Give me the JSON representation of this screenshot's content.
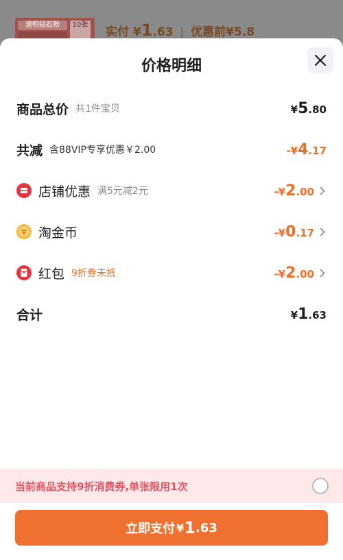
{
  "background": {
    "thumb_title": "透明钻石款",
    "thumb_count": "10张",
    "pay_label": "实付",
    "pay_currency": "¥",
    "pay_int": "1",
    "pay_dec": ".63",
    "separator": "|",
    "before_label": "优惠前",
    "before_price": "¥5.8"
  },
  "sheet": {
    "title": "价格明细",
    "rows": [
      {
        "label": "商品总价",
        "sub": "共1件宝贝",
        "currency": "¥",
        "int": "5",
        "dec": ".80"
      },
      {
        "label": "共减",
        "sub": "含88VIP专享优惠￥2.00",
        "currency": "-¥",
        "int": "4",
        "dec": ".17"
      },
      {
        "label": "店铺优惠",
        "sub": "满5元减2元",
        "currency": "-¥",
        "int": "2",
        "dec": ".00"
      },
      {
        "label": "淘金币",
        "sub": "",
        "currency": "-¥",
        "int": "0",
        "dec": ".17"
      },
      {
        "label": "红包",
        "sub": "9折券未抵",
        "currency": "-¥",
        "int": "2",
        "dec": ".00"
      },
      {
        "label": "合计",
        "sub": "",
        "currency": "¥",
        "int": "1",
        "dec": ".63"
      }
    ],
    "icons": [
      "store-coupon-icon",
      "taojinbi-coin-icon",
      "red-packet-icon"
    ]
  },
  "notice": {
    "text": "当前商品支持9折消费券,单张限用1次"
  },
  "pay_button": {
    "label": "立即支付",
    "currency": "¥",
    "int": "1",
    "dec": ".63"
  },
  "colors": {
    "accent": "#f07030",
    "discount": "#e8702a",
    "notice_bg": "#fde9ea",
    "notice_text": "#e25261"
  }
}
